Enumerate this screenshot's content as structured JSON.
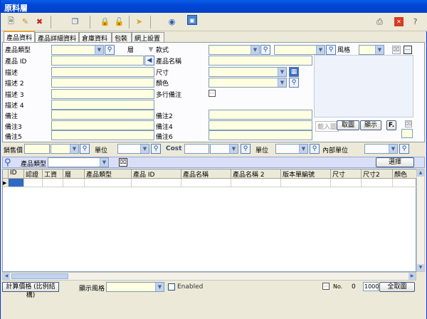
{
  "window": {
    "title": "原料層"
  },
  "tabs": [
    "產品資料",
    "產品詳細資料",
    "倉庫資料",
    "包裝",
    "網上設置"
  ],
  "form": {
    "product_category": "產品類型",
    "layer": "層",
    "style": "款式",
    "style_format": "風格",
    "product_id": "產品 ID",
    "product_name": "產品名稱",
    "desc": "描述",
    "desc2": "描述 2",
    "desc3": "描述 3",
    "desc4": "描述 4",
    "size": "尺寸",
    "color": "顏色",
    "multiline_remark": "多行備注",
    "remark": "備注",
    "remark2": "備注2",
    "remark3": "備注3",
    "remark4": "備注4",
    "remark5": "備注5",
    "remark6": "備注6",
    "import_image": "載入圖",
    "cancel_image": "取圖",
    "show": "顯示",
    "f_btn": "F.",
    "x_btn": "X",
    "c_btn": "C"
  },
  "pricebar": {
    "sale_price": "銷售價",
    "unit": "單位",
    "cost": "Cost",
    "unit2": "單位",
    "internal_unit": "內部單位"
  },
  "filter": {
    "label": "產品類型",
    "select_btn": "選擇"
  },
  "grid": {
    "columns": [
      "ID",
      "認證",
      "工資",
      "層",
      "產品類型",
      "產品 ID",
      "產品名稱",
      "產品名稱 2",
      "版本單編號",
      "尺寸",
      "尺寸2",
      "顏色"
    ]
  },
  "footer": {
    "calc_price": "計算價格 (比例結構)",
    "display_style": "顯示風格",
    "enabled": "Enabled",
    "no_label": "No.",
    "no_value": "0",
    "page_size": "1000",
    "all_images": "全取圖"
  }
}
